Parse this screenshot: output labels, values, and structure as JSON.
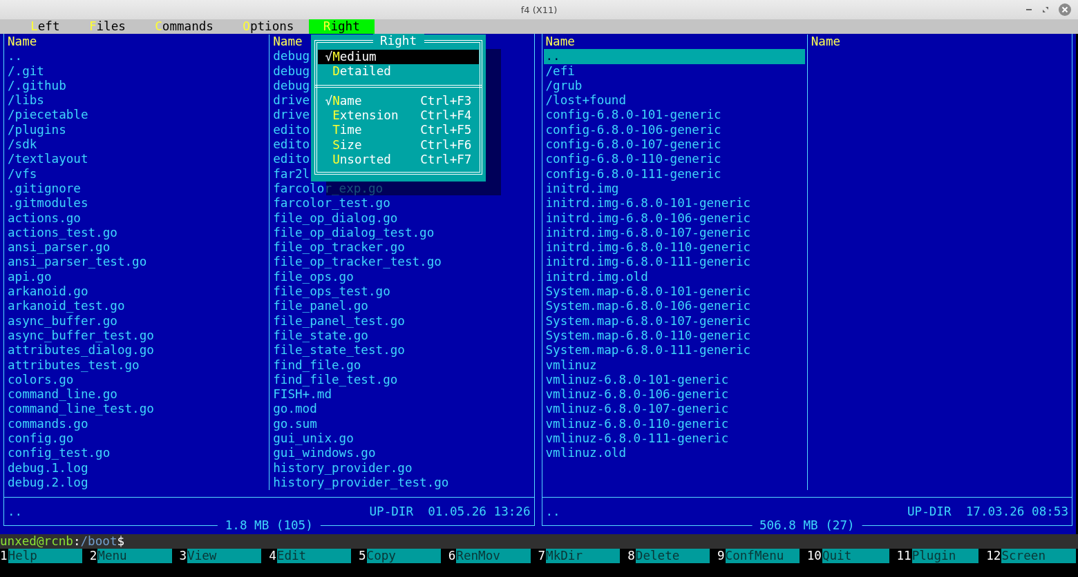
{
  "window": {
    "title": "f4 (X11)"
  },
  "menu": [
    {
      "label": "Left",
      "selected": false
    },
    {
      "label": "Files",
      "selected": false
    },
    {
      "label": "Commands",
      "selected": false
    },
    {
      "label": "Options",
      "selected": false
    },
    {
      "label": "Right",
      "selected": true
    }
  ],
  "panels": [
    {
      "columns": [
        {
          "header": "Name",
          "items": [
            {
              "name": "..",
              "selected": false
            },
            {
              "name": "/.git",
              "selected": false
            },
            {
              "name": "/.github",
              "selected": false
            },
            {
              "name": "/libs",
              "selected": false
            },
            {
              "name": "/piecetable",
              "selected": false
            },
            {
              "name": "/plugins",
              "selected": false
            },
            {
              "name": "/sdk",
              "selected": false
            },
            {
              "name": "/textlayout",
              "selected": false
            },
            {
              "name": "/vfs",
              "selected": false
            },
            {
              "name": ".gitignore",
              "selected": false
            },
            {
              "name": ".gitmodules",
              "selected": false
            },
            {
              "name": "actions.go",
              "selected": false
            },
            {
              "name": "actions_test.go",
              "selected": false
            },
            {
              "name": "ansi_parser.go",
              "selected": false
            },
            {
              "name": "ansi_parser_test.go",
              "selected": false
            },
            {
              "name": "api.go",
              "selected": false
            },
            {
              "name": "arkanoid.go",
              "selected": false
            },
            {
              "name": "arkanoid_test.go",
              "selected": false
            },
            {
              "name": "async_buffer.go",
              "selected": false
            },
            {
              "name": "async_buffer_test.go",
              "selected": false
            },
            {
              "name": "attributes_dialog.go",
              "selected": false
            },
            {
              "name": "attributes_test.go",
              "selected": false
            },
            {
              "name": "colors.go",
              "selected": false
            },
            {
              "name": "command_line.go",
              "selected": false
            },
            {
              "name": "command_line_test.go",
              "selected": false
            },
            {
              "name": "commands.go",
              "selected": false
            },
            {
              "name": "config.go",
              "selected": false
            },
            {
              "name": "config_test.go",
              "selected": false
            },
            {
              "name": "debug.1.log",
              "selected": false
            },
            {
              "name": "debug.2.log",
              "selected": false
            }
          ]
        },
        {
          "header": "Name",
          "items": [
            {
              "name": "debug",
              "selected": false
            },
            {
              "name": "debug",
              "selected": false
            },
            {
              "name": "debug",
              "selected": false
            },
            {
              "name": "drive",
              "selected": false
            },
            {
              "name": "drive",
              "selected": false
            },
            {
              "name": "edito",
              "selected": false
            },
            {
              "name": "edito",
              "selected": false
            },
            {
              "name": "edito",
              "selected": false
            },
            {
              "name": "far2l",
              "selected": false
            },
            {
              "name": "farcolor_exp.go",
              "selected": false
            },
            {
              "name": "farcolor_test.go",
              "selected": false
            },
            {
              "name": "file_op_dialog.go",
              "selected": false
            },
            {
              "name": "file_op_dialog_test.go",
              "selected": false
            },
            {
              "name": "file_op_tracker.go",
              "selected": false
            },
            {
              "name": "file_op_tracker_test.go",
              "selected": false
            },
            {
              "name": "file_ops.go",
              "selected": false
            },
            {
              "name": "file_ops_test.go",
              "selected": false
            },
            {
              "name": "file_panel.go",
              "selected": false
            },
            {
              "name": "file_panel_test.go",
              "selected": false
            },
            {
              "name": "file_state.go",
              "selected": false
            },
            {
              "name": "file_state_test.go",
              "selected": false
            },
            {
              "name": "find_file.go",
              "selected": false
            },
            {
              "name": "find_file_test.go",
              "selected": false
            },
            {
              "name": "FISH+.md",
              "selected": false
            },
            {
              "name": "go.mod",
              "selected": false
            },
            {
              "name": "go.sum",
              "selected": false
            },
            {
              "name": "gui_unix.go",
              "selected": false
            },
            {
              "name": "gui_windows.go",
              "selected": false
            },
            {
              "name": "history_provider.go",
              "selected": false
            },
            {
              "name": "history_provider_test.go",
              "selected": false
            }
          ]
        }
      ],
      "info": {
        "current": "..",
        "type": "UP-DIR",
        "datetime": "01.05.26 13:26"
      },
      "summary": "1.8 MB (105)"
    },
    {
      "columns": [
        {
          "header": "Name",
          "items": [
            {
              "name": "..",
              "selected": true
            },
            {
              "name": "/efi",
              "selected": false
            },
            {
              "name": "/grub",
              "selected": false
            },
            {
              "name": "/lost+found",
              "selected": false
            },
            {
              "name": "config-6.8.0-101-generic",
              "selected": false
            },
            {
              "name": "config-6.8.0-106-generic",
              "selected": false
            },
            {
              "name": "config-6.8.0-107-generic",
              "selected": false
            },
            {
              "name": "config-6.8.0-110-generic",
              "selected": false
            },
            {
              "name": "config-6.8.0-111-generic",
              "selected": false
            },
            {
              "name": "initrd.img",
              "selected": false
            },
            {
              "name": "initrd.img-6.8.0-101-generic",
              "selected": false
            },
            {
              "name": "initrd.img-6.8.0-106-generic",
              "selected": false
            },
            {
              "name": "initrd.img-6.8.0-107-generic",
              "selected": false
            },
            {
              "name": "initrd.img-6.8.0-110-generic",
              "selected": false
            },
            {
              "name": "initrd.img-6.8.0-111-generic",
              "selected": false
            },
            {
              "name": "initrd.img.old",
              "selected": false
            },
            {
              "name": "System.map-6.8.0-101-generic",
              "selected": false
            },
            {
              "name": "System.map-6.8.0-106-generic",
              "selected": false
            },
            {
              "name": "System.map-6.8.0-107-generic",
              "selected": false
            },
            {
              "name": "System.map-6.8.0-110-generic",
              "selected": false
            },
            {
              "name": "System.map-6.8.0-111-generic",
              "selected": false
            },
            {
              "name": "vmlinuz",
              "selected": false
            },
            {
              "name": "vmlinuz-6.8.0-101-generic",
              "selected": false
            },
            {
              "name": "vmlinuz-6.8.0-106-generic",
              "selected": false
            },
            {
              "name": "vmlinuz-6.8.0-107-generic",
              "selected": false
            },
            {
              "name": "vmlinuz-6.8.0-110-generic",
              "selected": false
            },
            {
              "name": "vmlinuz-6.8.0-111-generic",
              "selected": false
            },
            {
              "name": "vmlinuz.old",
              "selected": false
            }
          ]
        },
        {
          "header": "Name"
        }
      ],
      "info": {
        "current": "..",
        "type": "UP-DIR",
        "datetime": "17.03.26 08:53"
      },
      "summary": "506.8 MB (27)"
    }
  ],
  "popup": {
    "title": "Right",
    "check_mark": "√",
    "items": [
      {
        "kind": "item",
        "label": "Medium",
        "checked": true,
        "selected": true
      },
      {
        "kind": "item",
        "label": "Detailed",
        "checked": false,
        "selected": false
      },
      {
        "kind": "separator"
      },
      {
        "kind": "item",
        "label": "Name",
        "shortcut": "Ctrl+F3",
        "checked": true,
        "selected": false
      },
      {
        "kind": "item",
        "label": "Extension",
        "shortcut": "Ctrl+F4",
        "checked": false,
        "selected": false
      },
      {
        "kind": "item",
        "label": "Time",
        "shortcut": "Ctrl+F5",
        "checked": false,
        "selected": false
      },
      {
        "kind": "item",
        "label": "Size",
        "shortcut": "Ctrl+F6",
        "checked": false,
        "selected": false
      },
      {
        "kind": "item",
        "label": "Unsorted",
        "shortcut": "Ctrl+F7",
        "checked": false,
        "selected": false
      }
    ]
  },
  "prompt": {
    "user_host": "unxed@rcnb",
    "separator": ":",
    "path": "/boot",
    "symbol": "$"
  },
  "keys": [
    {
      "number": "1",
      "label": "Help"
    },
    {
      "number": "2",
      "label": "Menu"
    },
    {
      "number": "3",
      "label": "View"
    },
    {
      "number": "4",
      "label": "Edit"
    },
    {
      "number": "5",
      "label": "Copy"
    },
    {
      "number": "6",
      "label": "RenMov"
    },
    {
      "number": "7",
      "label": "MkDir"
    },
    {
      "number": "8",
      "label": "Delete"
    },
    {
      "number": "9",
      "label": "ConfMenu"
    },
    {
      "number": "10",
      "label": "Quit"
    },
    {
      "number": "11",
      "label": "Plugin"
    },
    {
      "number": "12",
      "label": "Screen"
    }
  ]
}
